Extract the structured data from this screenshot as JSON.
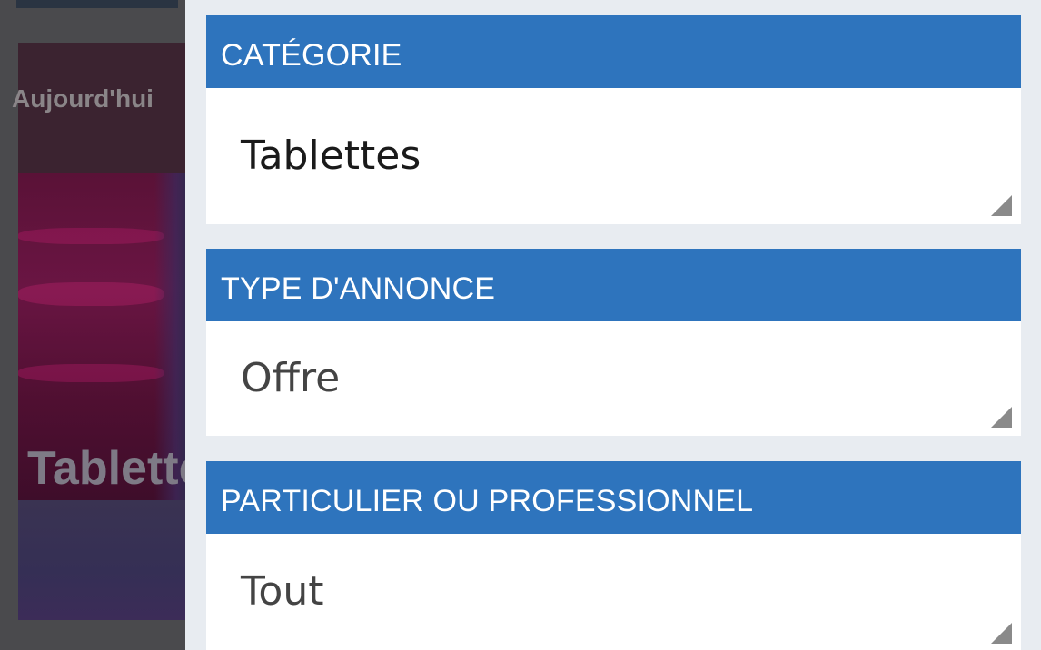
{
  "background": {
    "listing_date": "Aujourd'hui",
    "listing_title": "Tablettes"
  },
  "filters": [
    {
      "id": "category",
      "label": "CATÉGORIE",
      "value": "Tablettes"
    },
    {
      "id": "ad_type",
      "label": "TYPE D'ANNONCE",
      "value": "Offre"
    },
    {
      "id": "seller_type",
      "label": "PARTICULIER OU PROFESSIONNEL",
      "value": "Tout"
    }
  ],
  "colors": {
    "header_bg": "#2e74bd",
    "header_text": "#ffffff",
    "panel_bg": "#e8ecf1",
    "value_bg": "#ffffff",
    "dropdown_indicator": "#8a8a8a"
  },
  "icons": {
    "dropdown": "dropdown-corner-triangle-icon"
  }
}
